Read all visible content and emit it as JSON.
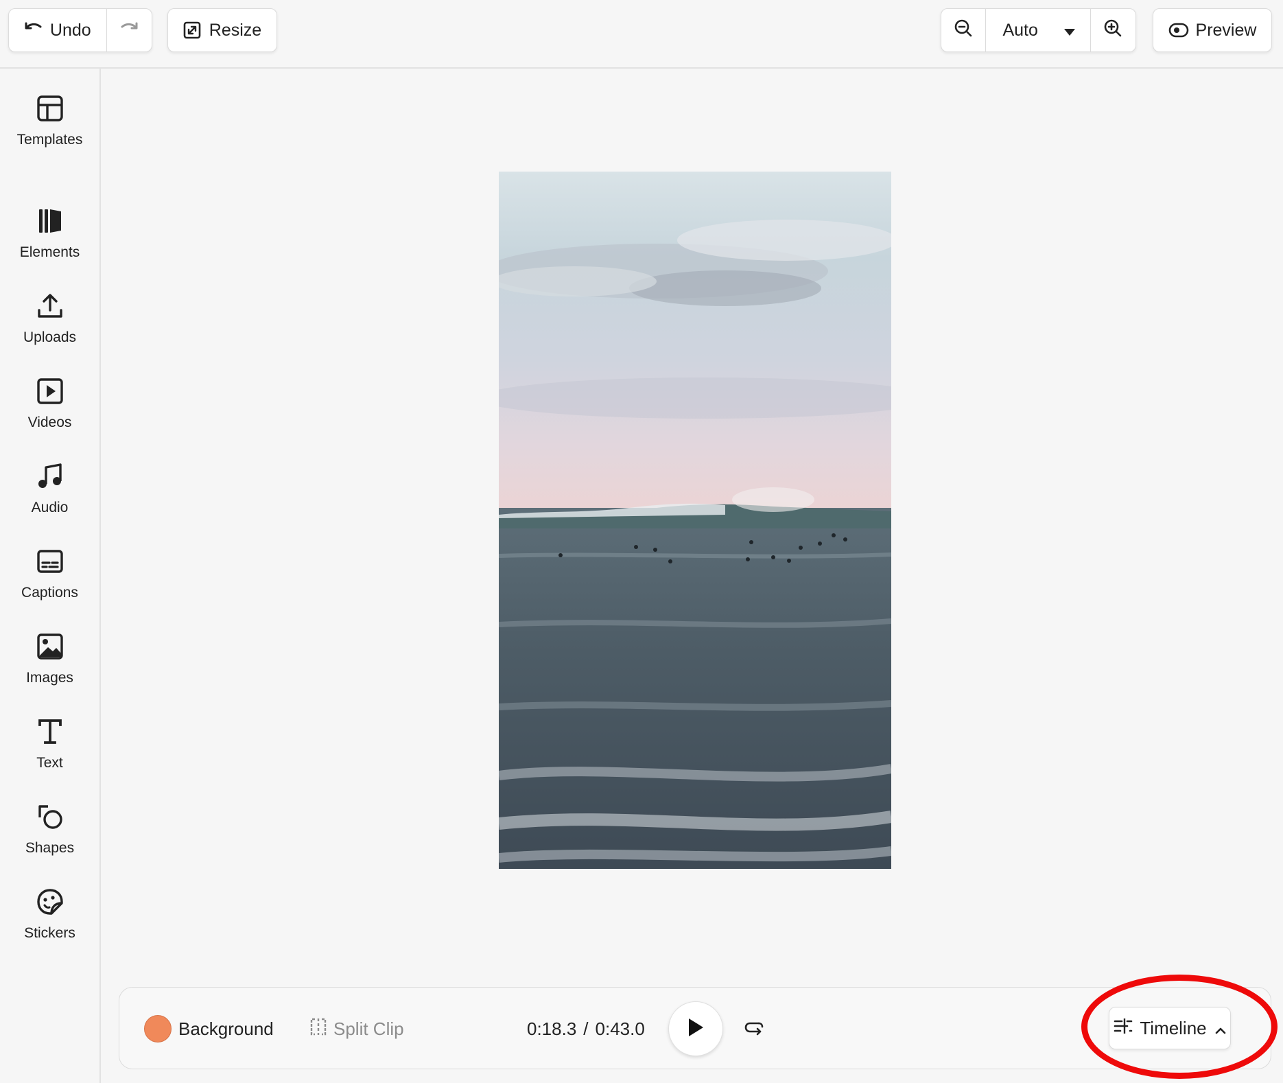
{
  "toolbar": {
    "undo_label": "Undo",
    "resize_label": "Resize",
    "zoom_value": "Auto",
    "preview_label": "Preview"
  },
  "sidebar": {
    "items": [
      {
        "label": "Templates",
        "icon": "layout-icon"
      },
      {
        "label": "Elements",
        "icon": "elements-icon"
      },
      {
        "label": "Uploads",
        "icon": "upload-icon"
      },
      {
        "label": "Videos",
        "icon": "video-icon"
      },
      {
        "label": "Audio",
        "icon": "music-note-icon"
      },
      {
        "label": "Captions",
        "icon": "captions-icon"
      },
      {
        "label": "Images",
        "icon": "image-icon"
      },
      {
        "label": "Text",
        "icon": "text-icon"
      },
      {
        "label": "Shapes",
        "icon": "shapes-icon"
      },
      {
        "label": "Stickers",
        "icon": "sticker-icon"
      }
    ]
  },
  "playback": {
    "background_label": "Background",
    "background_color": "#f0895a",
    "split_label": "Split Clip",
    "current_time": "0:18.3",
    "separator": "/",
    "total_time": "0:43.0",
    "timeline_label": "Timeline"
  },
  "colors": {
    "annotation": "#ee0a0a"
  }
}
